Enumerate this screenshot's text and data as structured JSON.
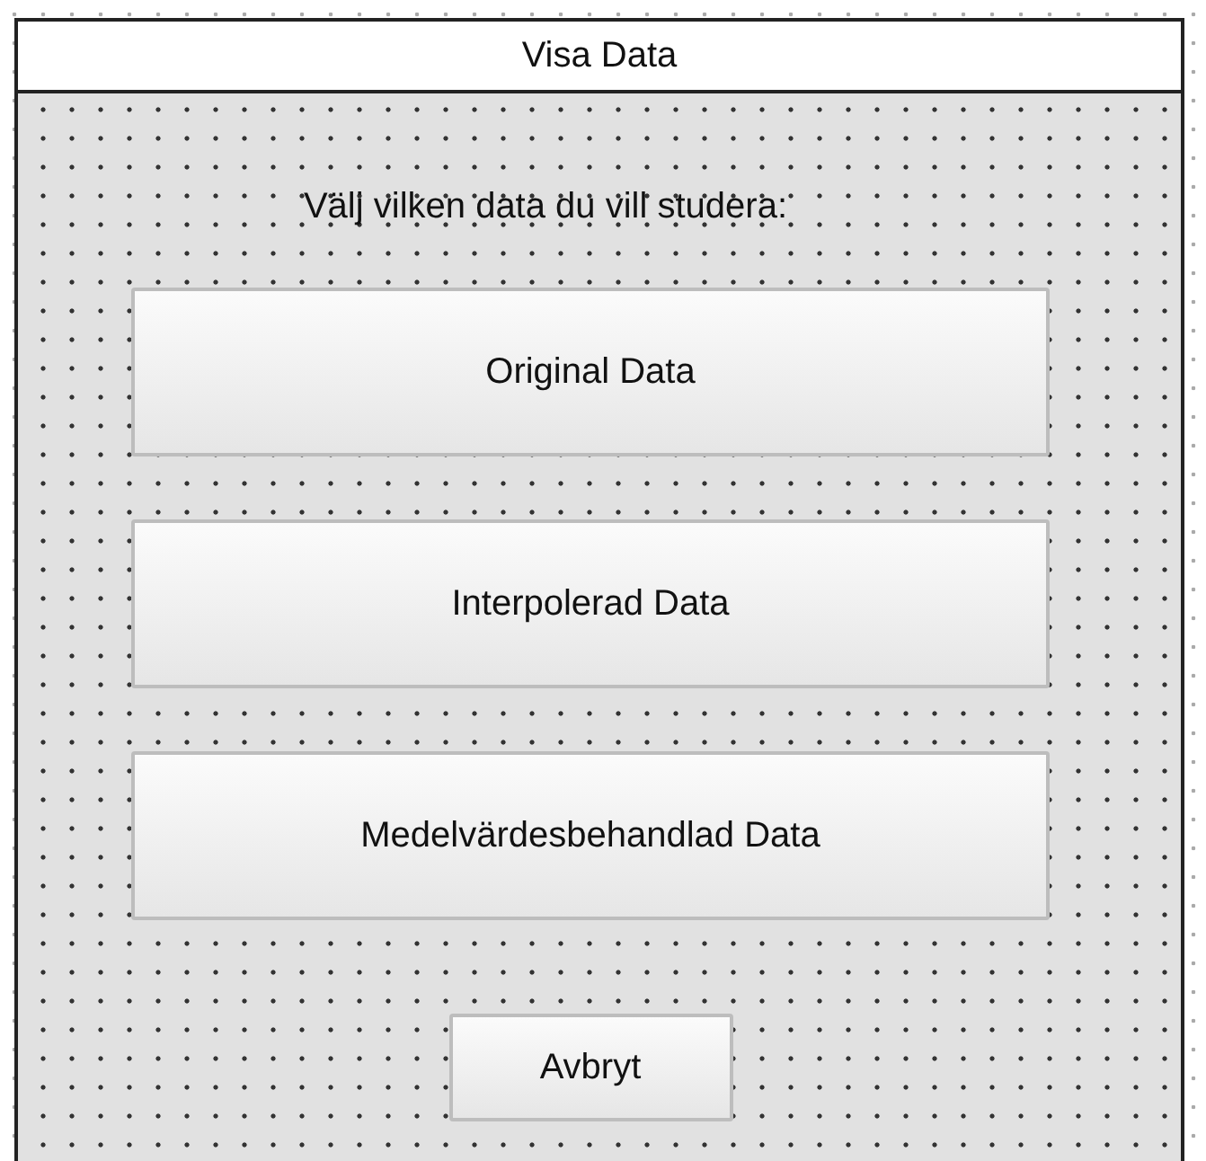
{
  "window": {
    "title": "Visa Data"
  },
  "prompt": "Välj vilken data du vill studera:",
  "choices": [
    "Original Data",
    "Interpolerad Data",
    "Medelvärdesbehandlad Data"
  ],
  "cancel": "Avbryt"
}
